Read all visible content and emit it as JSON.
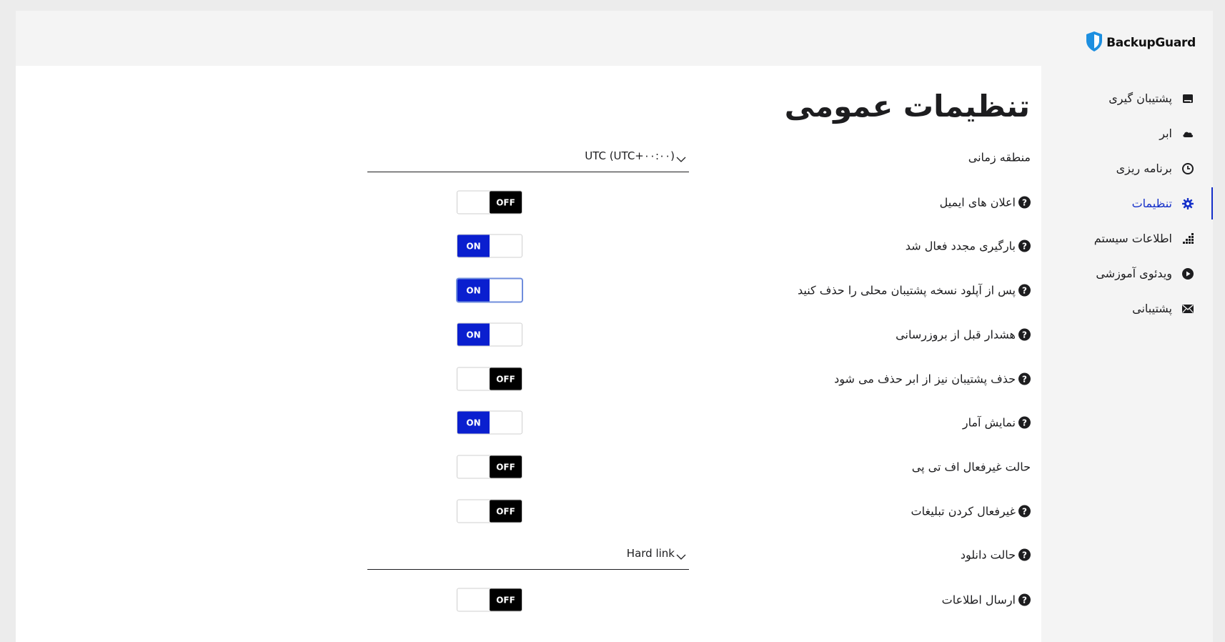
{
  "brand": {
    "name": "BackupGuard",
    "color": "#1d8fe0"
  },
  "sidebar": {
    "items": [
      {
        "label": "پشتیبان گیری",
        "icon": "drive-icon",
        "active": false
      },
      {
        "label": "ابر",
        "icon": "cloud-icon",
        "active": false
      },
      {
        "label": "برنامه ریزی",
        "icon": "clock-icon",
        "active": false
      },
      {
        "label": "تنظیمات",
        "icon": "gear-icon",
        "active": true
      },
      {
        "label": "اطلاعات سیستم",
        "icon": "system-info-icon",
        "active": false
      },
      {
        "label": "ویدئوی آموزشی",
        "icon": "play-icon",
        "active": false
      },
      {
        "label": "پشتیبانی",
        "icon": "envelope-icon",
        "active": false
      }
    ],
    "active_color": "#1530c9"
  },
  "page": {
    "title": "تنظیمات عمومی"
  },
  "settings": [
    {
      "label": "منطقه زمانی",
      "type": "select",
      "value": "UTC (UTC+۰۰:۰۰)",
      "help": false
    },
    {
      "label": "اعلان های ایمیل",
      "type": "toggle",
      "state": "OFF",
      "help": true
    },
    {
      "label": "بارگیری مجدد فعال شد",
      "type": "toggle",
      "state": "ON",
      "help": true
    },
    {
      "label": "پس از آپلود نسخه پشتیبان محلی را حذف کنید",
      "type": "toggle",
      "state": "ON",
      "help": true,
      "focused": true
    },
    {
      "label": "هشدار قبل از بروزرسانی",
      "type": "toggle",
      "state": "ON",
      "help": true
    },
    {
      "label": "حذف پشتیبان نیز از ابر حذف می شود",
      "type": "toggle",
      "state": "OFF",
      "help": true
    },
    {
      "label": "نمایش آمار",
      "type": "toggle",
      "state": "ON",
      "help": true
    },
    {
      "label": "حالت غیرفعال اف تی پی",
      "type": "toggle",
      "state": "OFF",
      "help": false
    },
    {
      "label": "غیرفعال کردن تبلیغات",
      "type": "toggle",
      "state": "OFF",
      "help": true
    },
    {
      "label": "حالت دانلود",
      "type": "select",
      "value": "Hard link",
      "help": true
    },
    {
      "label": "ارسال اطلاعات",
      "type": "toggle",
      "state": "OFF",
      "help": true
    }
  ],
  "toggle_colors": {
    "on": "#0a1fcf",
    "off": "#000000"
  }
}
